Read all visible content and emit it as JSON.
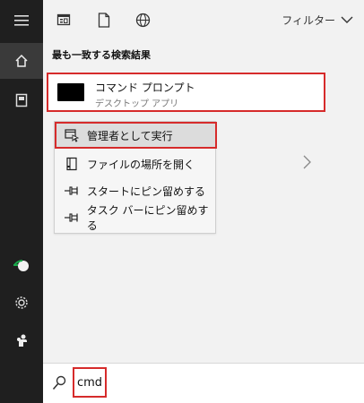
{
  "topbar": {
    "filter_label": "フィルター"
  },
  "results": {
    "section_title": "最も一致する検索結果",
    "best_match": {
      "title": "コマンド プロンプト",
      "subtitle": "デスクトップ アプリ"
    }
  },
  "context_menu": {
    "items": [
      {
        "label": "管理者として実行",
        "icon": "run-as-admin-icon"
      },
      {
        "label": "ファイルの場所を開く",
        "icon": "file-location-icon"
      },
      {
        "label": "スタートにピン留めする",
        "icon": "pin-icon"
      },
      {
        "label": "タスク バーにピン留めする",
        "icon": "pin-icon"
      }
    ]
  },
  "search": {
    "query": "cmd"
  },
  "colors": {
    "rail_bg": "#1f1f1f",
    "pane_bg": "#f2f2f2",
    "highlight_border": "#d62b2b"
  }
}
